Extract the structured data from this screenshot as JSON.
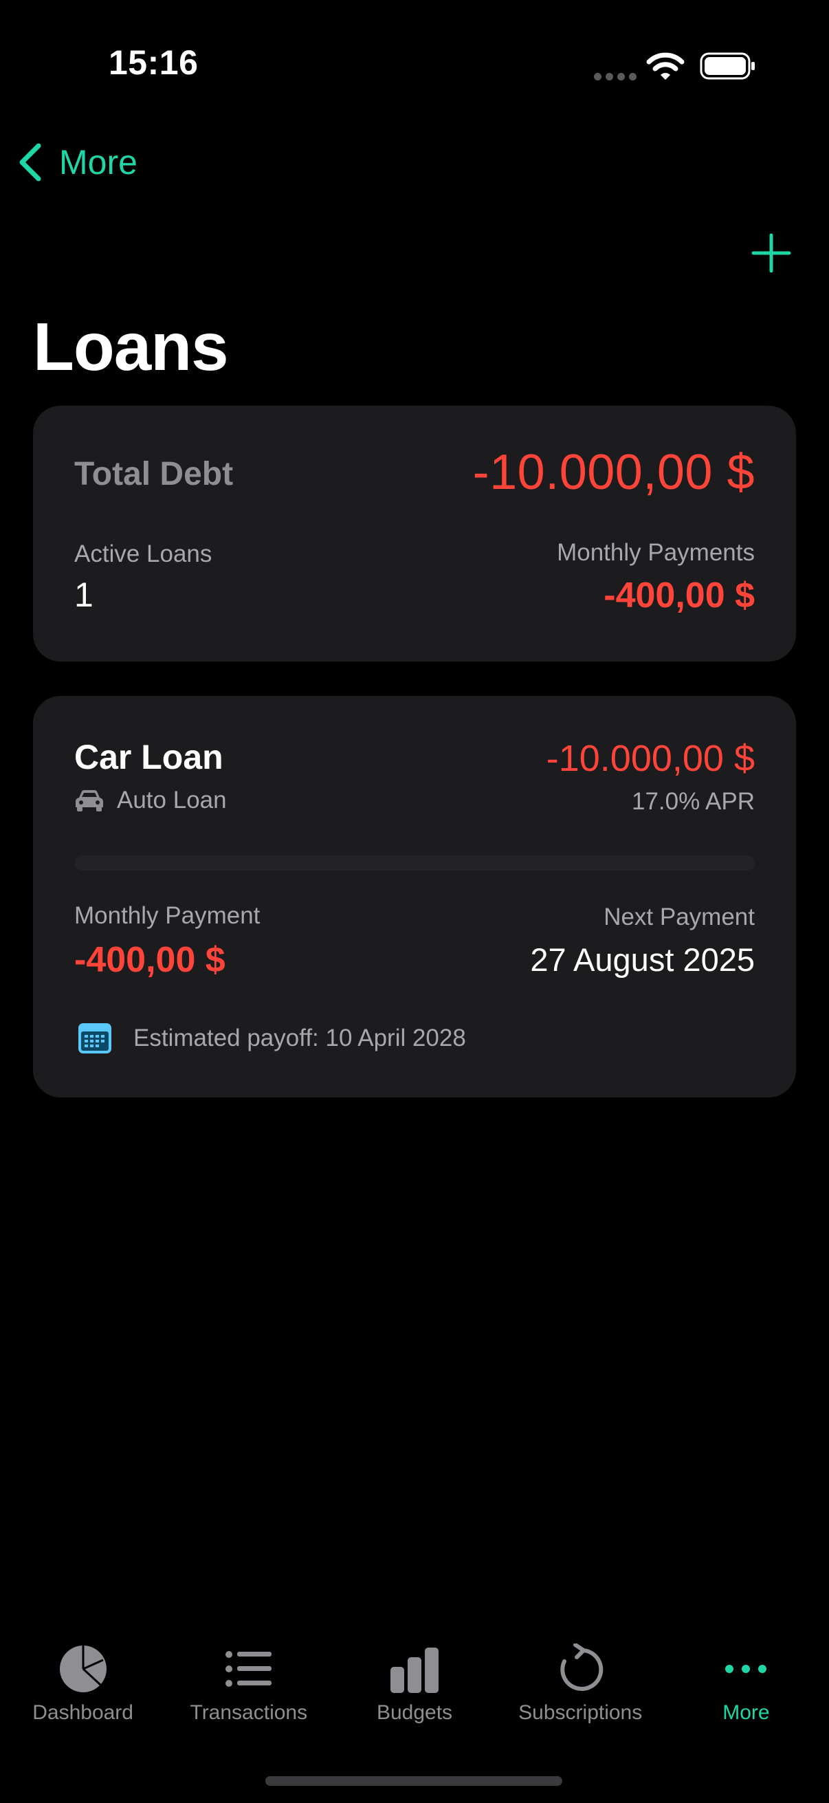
{
  "status_bar": {
    "time": "15:16"
  },
  "nav": {
    "back_label": "More"
  },
  "page": {
    "title": "Loans"
  },
  "summary": {
    "total_debt_label": "Total Debt",
    "total_debt_value": "-10.000,00 $",
    "active_loans_label": "Active Loans",
    "active_loans_value": "1",
    "monthly_payments_label": "Monthly Payments",
    "monthly_payments_value": "-400,00 $"
  },
  "loans": [
    {
      "name": "Car Loan",
      "type": "Auto Loan",
      "icon": "car-icon",
      "amount": "-10.000,00 $",
      "apr": "17.0% APR",
      "monthly_payment_label": "Monthly Payment",
      "monthly_payment_value": "-400,00 $",
      "next_payment_label": "Next Payment",
      "next_payment_value": "27 August 2025",
      "payoff_text": "Estimated payoff: 10 April 2028",
      "progress_fraction": 0.0
    }
  ],
  "tabs": [
    {
      "label": "Dashboard",
      "icon": "pie-chart-icon",
      "active": false
    },
    {
      "label": "Transactions",
      "icon": "list-icon",
      "active": false
    },
    {
      "label": "Budgets",
      "icon": "bar-chart-icon",
      "active": false
    },
    {
      "label": "Subscriptions",
      "icon": "refresh-icon",
      "active": false
    },
    {
      "label": "More",
      "icon": "more-icon",
      "active": true
    }
  ],
  "colors": {
    "accent": "#1fd6a6",
    "negative": "#ff453a",
    "card": "#1c1c1e",
    "secondary_text": "#a7a7ad"
  }
}
